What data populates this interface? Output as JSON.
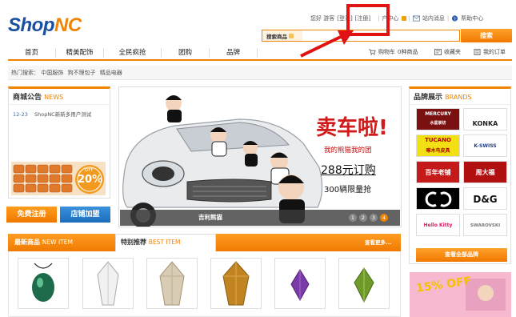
{
  "logo": {
    "shop": "Shop",
    "nc": "NC"
  },
  "topbar": {
    "greeting": "您好 游客",
    "login": "[登录]",
    "register": "[注册]",
    "user_center": "户中心",
    "messages": "站内消息",
    "help": "帮助中心"
  },
  "search": {
    "select_label": "搜索商品",
    "button": "搜索"
  },
  "nav": {
    "items": [
      "首页",
      "精美配饰",
      "全民疯抢",
      "团购",
      "品牌"
    ],
    "cart": "购物车",
    "cart_count": "0种商品",
    "favorites": "收藏夹",
    "orders": "我的订单"
  },
  "hot_search": {
    "label": "热门搜索：",
    "terms": [
      "中国服饰",
      "狗不理包子",
      "精品电器"
    ]
  },
  "news": {
    "title": "商城公告",
    "title_en": "NEWS",
    "item_date": "12-23",
    "item_text": "ShopNC新新多用户测试",
    "badge_line1": "OFF",
    "badge_line2": "20%"
  },
  "cta": {
    "register": "免费注册",
    "join": "店铺加盟"
  },
  "banner": {
    "headline": "卖车啦!",
    "sub": "我的熊猫我的团",
    "price": "288元订购",
    "limit": "300辆限量抢",
    "caption": "吉利熊猫",
    "pages": [
      "1",
      "2",
      "3",
      "4"
    ],
    "active_page": "4"
  },
  "brands": {
    "title": "品牌展示",
    "title_en": "BRANDS",
    "items": [
      {
        "name": "MERCURY",
        "cn": "水星家纺",
        "bg": "#7a1010",
        "fg": "#ffffff"
      },
      {
        "name": "KONKA",
        "cn": "",
        "bg": "#ffffff",
        "fg": "#222222"
      },
      {
        "name": "TUCANO",
        "cn": "啄木鸟皮具",
        "bg": "#f3e014",
        "fg": "#b20000"
      },
      {
        "name": "K-SWISS",
        "cn": "",
        "bg": "#ffffff",
        "fg": "#1b3f8a"
      },
      {
        "name": "百年老铺",
        "cn": "",
        "bg": "#c41a1a",
        "fg": "#ffffff"
      },
      {
        "name": "周大福",
        "cn": "",
        "bg": "#b01010",
        "fg": "#ffffff"
      },
      {
        "name": "CHANEL",
        "cn": "",
        "bg": "#000000",
        "fg": "#ffffff"
      },
      {
        "name": "D&G",
        "cn": "",
        "bg": "#ffffff",
        "fg": "#111111"
      },
      {
        "name": "Hello Kitty",
        "cn": "",
        "bg": "#ffffff",
        "fg": "#e0115f"
      },
      {
        "name": "SWAROVSKI",
        "cn": "",
        "bg": "#ffffff",
        "fg": "#777777"
      }
    ],
    "all_button": "查看全部品牌"
  },
  "tabs": {
    "new_item": "最新商品",
    "new_item_en": "NEW ITEM",
    "best_item": "特别推荐",
    "best_item_en": "BEST ITEM",
    "more": "查看更多..."
  },
  "promo": {
    "text": "15% OFF"
  },
  "colors": {
    "accent": "#f08300",
    "brand_blue": "#1a4fa3",
    "annotation": "#e01212"
  }
}
